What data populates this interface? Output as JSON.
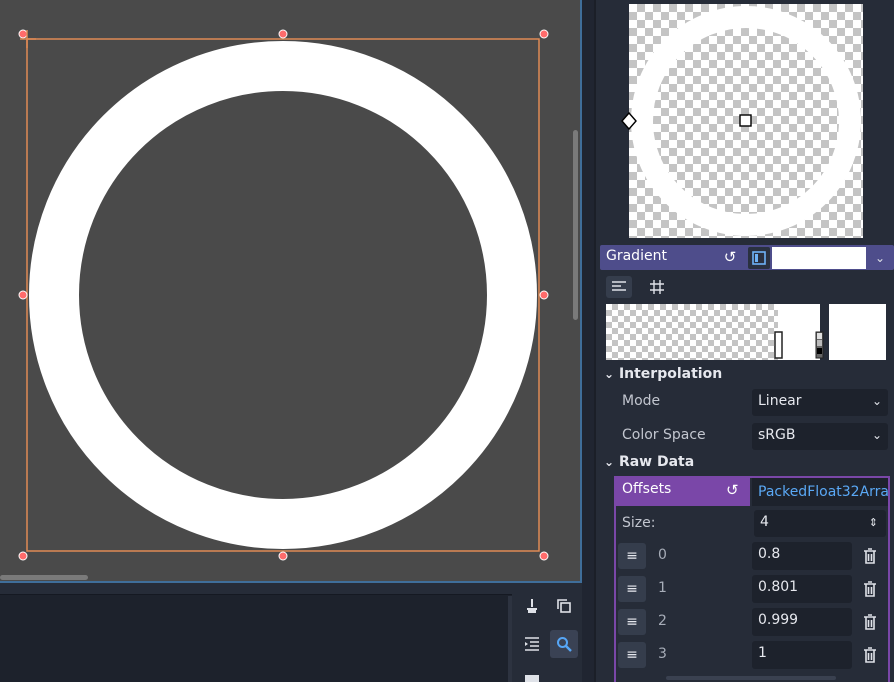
{
  "inspector": {
    "gradient": {
      "label": "Gradient",
      "interpolation": {
        "section": "Interpolation",
        "mode_label": "Mode",
        "mode_value": "Linear",
        "color_space_label": "Color Space",
        "color_space_value": "sRGB"
      },
      "raw_data": {
        "section": "Raw Data",
        "offsets_label": "Offsets",
        "offsets_type": "PackedFloat32Arra",
        "size_label": "Size:",
        "size_value": "4",
        "items": [
          {
            "index": "0",
            "value": "0.8"
          },
          {
            "index": "1",
            "value": "0.801"
          },
          {
            "index": "2",
            "value": "0.999"
          },
          {
            "index": "3",
            "value": "1"
          }
        ]
      }
    }
  },
  "colors": {
    "viewport_bg": "#4a4a4a",
    "selection": "#e08a55",
    "handle": "#ff6b6b",
    "gradient_header": "#4e4d8b",
    "offsets_header": "#7a47a8",
    "accent": "#5aa8f5"
  }
}
